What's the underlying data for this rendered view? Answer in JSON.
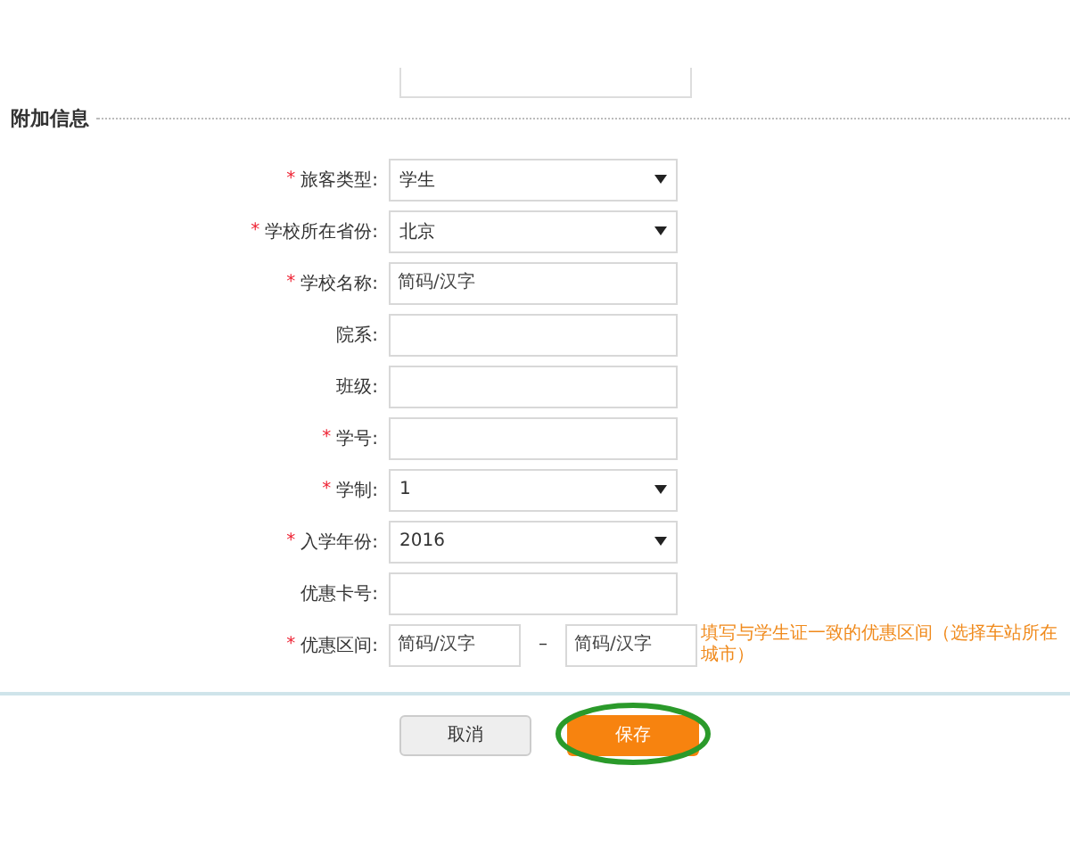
{
  "section_title": "附加信息",
  "fields": [
    {
      "label": "旅客类型:",
      "required_mark": "*",
      "kind": "select",
      "value": "学生"
    },
    {
      "label": "学校所在省份:",
      "required_mark": "*",
      "kind": "select",
      "value": "北京"
    },
    {
      "label": "学校名称:",
      "required_mark": "*",
      "kind": "input",
      "placeholder": "简码/汉字"
    },
    {
      "label": "院系:",
      "kind": "input"
    },
    {
      "label": "班级:",
      "kind": "input"
    },
    {
      "label": "学号:",
      "required_mark": "*",
      "kind": "input"
    },
    {
      "label": "学制:",
      "required_mark": "*",
      "kind": "select",
      "value": "1"
    },
    {
      "label": "入学年份:",
      "required_mark": "*",
      "kind": "select",
      "value": "2016"
    },
    {
      "label": "优惠卡号:",
      "kind": "input"
    },
    {
      "label": "优惠区间:",
      "required_mark": "*",
      "kind": "range",
      "from_placeholder": "简码/汉字",
      "separator": "–",
      "to_placeholder": "简码/汉字",
      "hint": "填写与学生证一致的优惠区间（选择车站所在城市）"
    }
  ],
  "buttons": [
    {
      "label": "取消",
      "kind": "secondary",
      "circled": false
    },
    {
      "label": "保存",
      "kind": "primary",
      "circled": true
    }
  ]
}
